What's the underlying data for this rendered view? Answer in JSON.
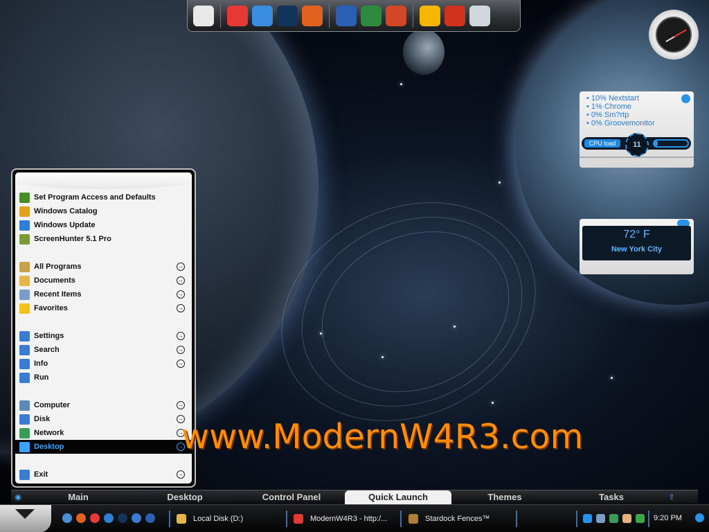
{
  "watermark": "www.ModernW4R3.com",
  "dock": {
    "icons": [
      {
        "name": "notepad-icon",
        "color": "#e8e8e8"
      },
      {
        "name": "chrome-icon",
        "color": "#e53935"
      },
      {
        "name": "safari-icon",
        "color": "#3a8de0"
      },
      {
        "name": "earth-icon",
        "color": "#12345a"
      },
      {
        "name": "firefox-icon",
        "color": "#e0621e"
      },
      {
        "name": "word-icon",
        "color": "#2b5fb4"
      },
      {
        "name": "excel-icon",
        "color": "#2e8b3e"
      },
      {
        "name": "powerpoint-icon",
        "color": "#d24726"
      },
      {
        "name": "winamp-icon",
        "color": "#f6b500"
      },
      {
        "name": "ccleaner-icon",
        "color": "#d0321e"
      },
      {
        "name": "recycle-bin-icon",
        "color": "#cfd8dc"
      }
    ]
  },
  "cpu": {
    "processes": [
      "• 10% Nextstart",
      "• 1% Chrome",
      "• 0% Sm?rtp",
      "• 0% Groovemonitor"
    ],
    "label": "CPU load",
    "value": "11",
    "bar_fraction": 0.11
  },
  "weather": {
    "temp": "72° F",
    "city": "New York City"
  },
  "menu": {
    "items": [
      {
        "label": "Set Program Access and Defaults",
        "arrow": false,
        "icon": "#4a8c2a"
      },
      {
        "label": "Windows Catalog",
        "arrow": false,
        "icon": "#e0a020"
      },
      {
        "label": "Windows Update",
        "arrow": false,
        "icon": "#2f7fd6"
      },
      {
        "label": "ScreenHunter 5.1 Pro",
        "arrow": false,
        "icon": "#7a9a3a"
      },
      {
        "gap": true
      },
      {
        "label": "All Programs",
        "arrow": true,
        "icon": "#c8a24a"
      },
      {
        "label": "Documents",
        "arrow": true,
        "icon": "#e2b64a"
      },
      {
        "label": "Recent Items",
        "arrow": true,
        "icon": "#7a9cc6"
      },
      {
        "label": "Favorites",
        "arrow": true,
        "icon": "#f2c21e"
      },
      {
        "gap": true
      },
      {
        "label": "Settings",
        "arrow": true,
        "icon": "#3b7bd0"
      },
      {
        "label": "Search",
        "arrow": true,
        "icon": "#3b7bd0"
      },
      {
        "label": "Info",
        "arrow": true,
        "icon": "#3b7bd0"
      },
      {
        "label": "Run",
        "arrow": false,
        "icon": "#3b7bd0"
      },
      {
        "gap": true
      },
      {
        "label": "Computer",
        "arrow": true,
        "icon": "#5f88b8"
      },
      {
        "label": "Disk",
        "arrow": true,
        "icon": "#3b7bd0"
      },
      {
        "label": "Network",
        "arrow": true,
        "icon": "#3a9a5a"
      },
      {
        "label": "Desktop",
        "arrow": true,
        "icon": "#3aa2ff",
        "selected": true
      },
      {
        "gap": true
      },
      {
        "label": "Exit",
        "arrow": true,
        "icon": "#3b7bd0"
      }
    ]
  },
  "tabs": [
    "Main",
    "Desktop",
    "Control Panel",
    "Quick Launch",
    "Themes",
    "Tasks"
  ],
  "active_tab": "Quick Launch",
  "taskbar": {
    "quick_icons": [
      {
        "name": "ie-globe-icon",
        "color": "#4a8fd6"
      },
      {
        "name": "firefox-icon",
        "color": "#e0621e"
      },
      {
        "name": "chrome-icon",
        "color": "#e53935"
      },
      {
        "name": "ie-icon",
        "color": "#2f7fd6"
      },
      {
        "name": "earth-icon",
        "color": "#12345a"
      },
      {
        "name": "settings-icon",
        "color": "#3b7bd0"
      },
      {
        "name": "media-player-icon",
        "color": "#2b5fb4"
      }
    ],
    "tasks": [
      {
        "label": "Local Disk (D:)",
        "icon": "#e2b64a"
      },
      {
        "label": "ModernW4R3 - http:/...",
        "icon": "#e53935"
      },
      {
        "label": "Stardock Fences™",
        "icon": "#b0803a"
      }
    ],
    "tray_icons": [
      {
        "name": "back-arrow-icon",
        "color": "#2b93e6"
      },
      {
        "name": "network-icon",
        "color": "#7a9cc6"
      },
      {
        "name": "update-icon",
        "color": "#3a9a5a"
      },
      {
        "name": "hand-icon",
        "color": "#e8b07a"
      },
      {
        "name": "info-icon",
        "color": "#3aa84a"
      }
    ],
    "time": "9:20 PM"
  }
}
